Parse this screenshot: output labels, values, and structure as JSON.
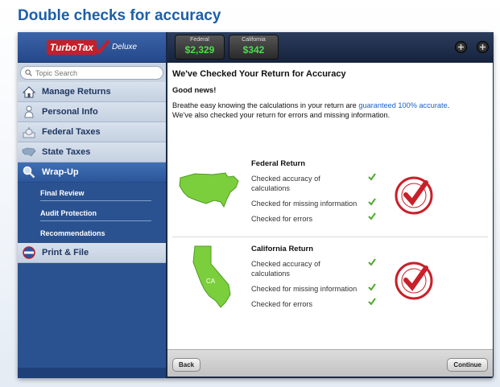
{
  "page_title": "Double checks for accuracy",
  "app": {
    "brand": "TurboTax",
    "edition": "Deluxe"
  },
  "search": {
    "placeholder": "Topic Search"
  },
  "sidebar": {
    "items": [
      {
        "label": "Manage Returns",
        "icon": "house-icon"
      },
      {
        "label": "Personal Info",
        "icon": "person-icon"
      },
      {
        "label": "Federal Taxes",
        "icon": "capitol-building-icon"
      },
      {
        "label": "State Taxes",
        "icon": "us-map-icon"
      },
      {
        "label": "Wrap-Up",
        "icon": "magnifier-icon",
        "active": true
      },
      {
        "label": "Print & File",
        "icon": "globe-file-icon"
      }
    ],
    "sub_items": [
      {
        "label": "Final Review"
      },
      {
        "label": "Audit Protection"
      },
      {
        "label": "Recommendations"
      }
    ]
  },
  "refund_meters": [
    {
      "label": "Federal",
      "amount": "$2,329"
    },
    {
      "label": "California",
      "amount": "$342"
    }
  ],
  "content": {
    "heading": "We've Checked Your Return for Accuracy",
    "good_news": "Good news!",
    "intro_before_link": "Breathe easy knowing the calculations in your return are ",
    "intro_link": "guaranteed 100% accurate",
    "intro_after_link": ".",
    "intro_line2": "We've also checked your return for errors and missing information.",
    "federal": {
      "title": "Federal Return",
      "checks": [
        "Checked accuracy of calculations",
        "Checked for missing information",
        "Checked for errors"
      ]
    },
    "california": {
      "title": "California Return",
      "map_label": "CA",
      "checks": [
        "Checked accuracy of calculations",
        "Checked for missing information",
        "Checked for errors"
      ]
    },
    "seal_text": "GUARANTEED 100% ACCURATE CALCULATIONS"
  },
  "footer": {
    "back_label": "Back",
    "continue_label": "Continue"
  },
  "colors": {
    "accent": "#1d5fa8",
    "check_green": "#4caa2c",
    "seal_red": "#c8202a",
    "map_green": "#7ccf3c"
  }
}
